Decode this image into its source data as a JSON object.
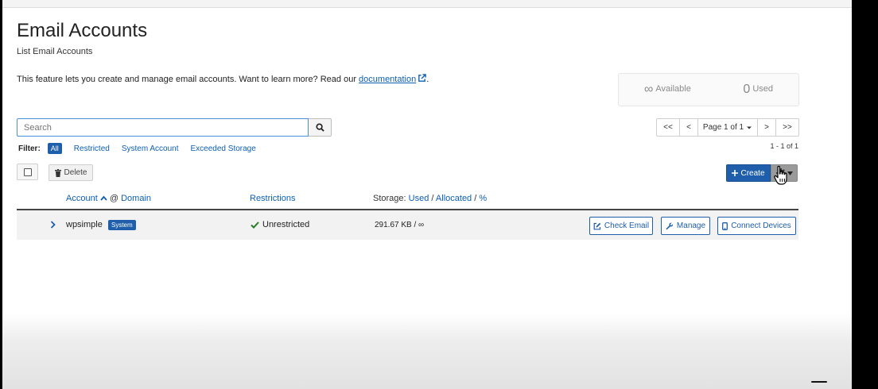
{
  "page": {
    "title": "Email Accounts",
    "subtitle": "List Email Accounts",
    "intro_text": "This feature lets you create and manage email accounts. Want to learn more? Read our ",
    "intro_link": "documentation",
    "intro_end": "."
  },
  "stats": {
    "available_symbol": "∞",
    "available_label": "Available",
    "used_value": "0",
    "used_label": "Used"
  },
  "search": {
    "placeholder": "Search"
  },
  "filter": {
    "label": "Filter:",
    "options": [
      "All",
      "Restricted",
      "System Account",
      "Exceeded Storage"
    ],
    "active": "All"
  },
  "pagination": {
    "first": "<<",
    "prev": "<",
    "page_label": "Page 1 of 1",
    "next": ">",
    "last": ">>",
    "range": "1 - 1 of 1"
  },
  "toolbar": {
    "delete_label": "Delete",
    "create_label": "Create"
  },
  "table": {
    "headers": {
      "account": "Account",
      "at": "@",
      "domain": "Domain",
      "restrictions": "Restrictions",
      "storage_prefix": "Storage:",
      "used": "Used",
      "sep": "/",
      "allocated": "Allocated",
      "percent": "%"
    },
    "rows": [
      {
        "account": "wpsimple",
        "badge": "System",
        "restriction": "Unrestricted",
        "storage": "291.67 KB / ∞",
        "actions": [
          "Check Email",
          "Manage",
          "Connect Devices"
        ]
      }
    ]
  },
  "colors": {
    "primary": "#1f5eaa",
    "link": "#0d5fb3",
    "success": "#2a7a2a"
  },
  "icons": [
    "external-link-icon",
    "search-icon",
    "trash-icon",
    "plus-icon",
    "gear-icon",
    "chevron-right-icon",
    "check-icon",
    "sort-up-icon",
    "pencil-square-icon",
    "wrench-icon",
    "mobile-icon",
    "hand-cursor-icon"
  ]
}
